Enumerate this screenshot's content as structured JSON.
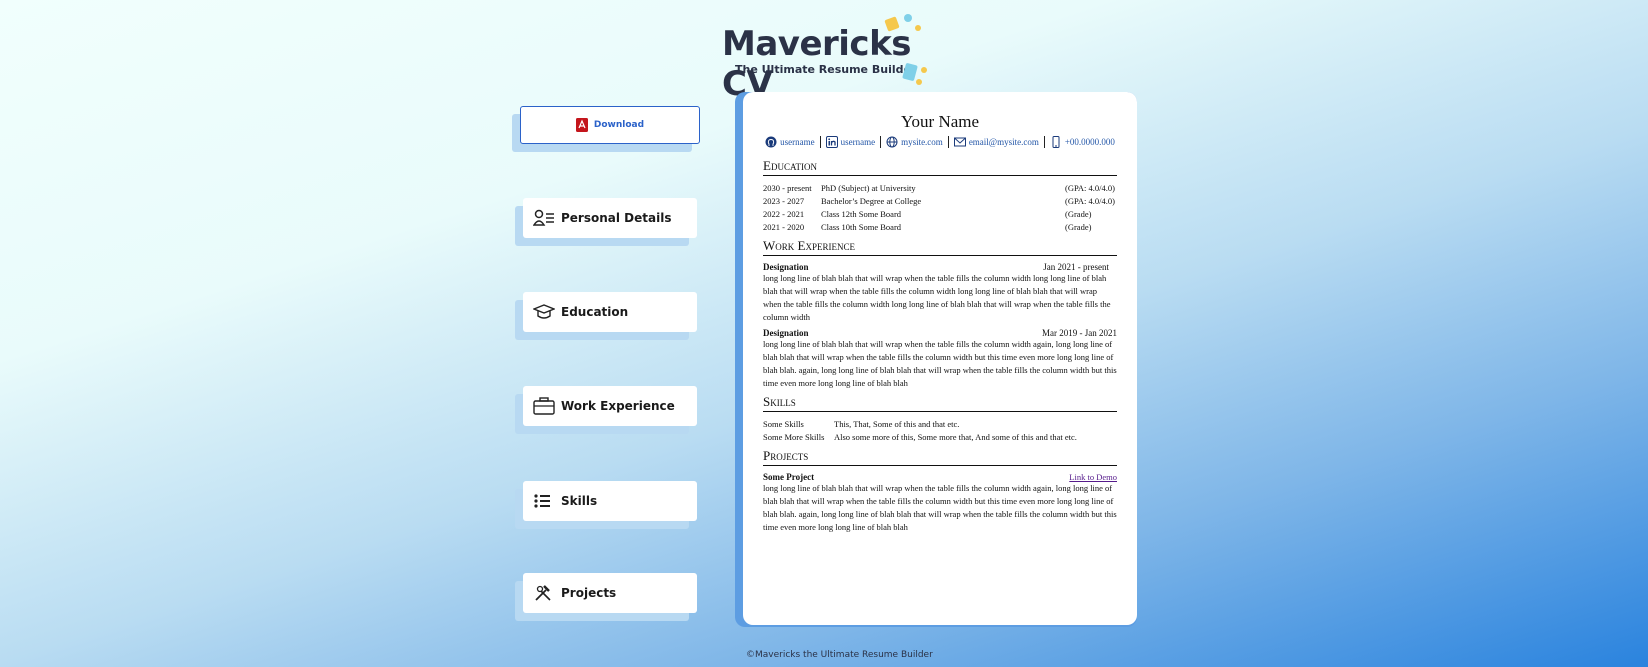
{
  "logo": {
    "word": "Mavericks CV",
    "tagline": "The Ultimate Resume Builder"
  },
  "nav": {
    "download": "Download",
    "personal": "Personal Details",
    "education": "Education",
    "work": "Work Experience",
    "skills": "Skills",
    "projects": "Projects"
  },
  "resume": {
    "name": "Your Name",
    "contacts": {
      "github": "username",
      "linkedin": "username",
      "site": "mysite.com",
      "email": "email@mysite.com",
      "phone": "+00.0000.000"
    },
    "sections": {
      "education": "Education",
      "work": "Work Experience",
      "skills": "Skills",
      "projects": "Projects"
    },
    "education": [
      {
        "dates": "2030 - present",
        "title": "PhD (Subject) at University",
        "grade": "(GPA: 4.0/4.0)"
      },
      {
        "dates": "2023 - 2027",
        "title": "Bachelor’s Degree at College",
        "grade": "(GPA: 4.0/4.0)"
      },
      {
        "dates": "2022 - 2021",
        "title": "Class 12th Some Board",
        "grade": "(Grade)"
      },
      {
        "dates": "2021 - 2020",
        "title": "Class 10th Some Board",
        "grade": "(Grade)"
      }
    ],
    "work": [
      {
        "designation": "Designation",
        "dates": "Jan 2021 - present",
        "desc": "long long line of blah blah that will wrap when the table fills the column width long long line of blah blah that will wrap when the table fills the column width long long line of blah blah that will wrap when the table fills the column width long long line of blah blah that will wrap when the table fills the column width"
      },
      {
        "designation": "Designation",
        "dates": "Mar 2019 - Jan 2021",
        "desc": "long long line of blah blah that will wrap when the table fills the column width again, long long line of blah blah that will wrap when the table fills the column width but this time even more long long line of blah blah. again, long long line of blah blah that will wrap when the table fills the column width but this time even more long long line of blah blah"
      }
    ],
    "skills": [
      {
        "key": "Some Skills",
        "value": "This, That, Some of this and that etc."
      },
      {
        "key": "Some More Skills",
        "value": "Also some more of this, Some more that, And some of this and that etc."
      }
    ],
    "project": {
      "name": "Some Project",
      "link": "Link to Demo",
      "desc": "long long line of blah blah that will wrap when the table fills the column width again, long long line of blah blah that will wrap when the table fills the column width but this time even more long long line of blah blah. again, long long line of blah blah that will wrap when the table fills the column width but this time even more long long line of blah blah"
    }
  },
  "footer": "©Mavericks the Ultimate Resume Builder"
}
